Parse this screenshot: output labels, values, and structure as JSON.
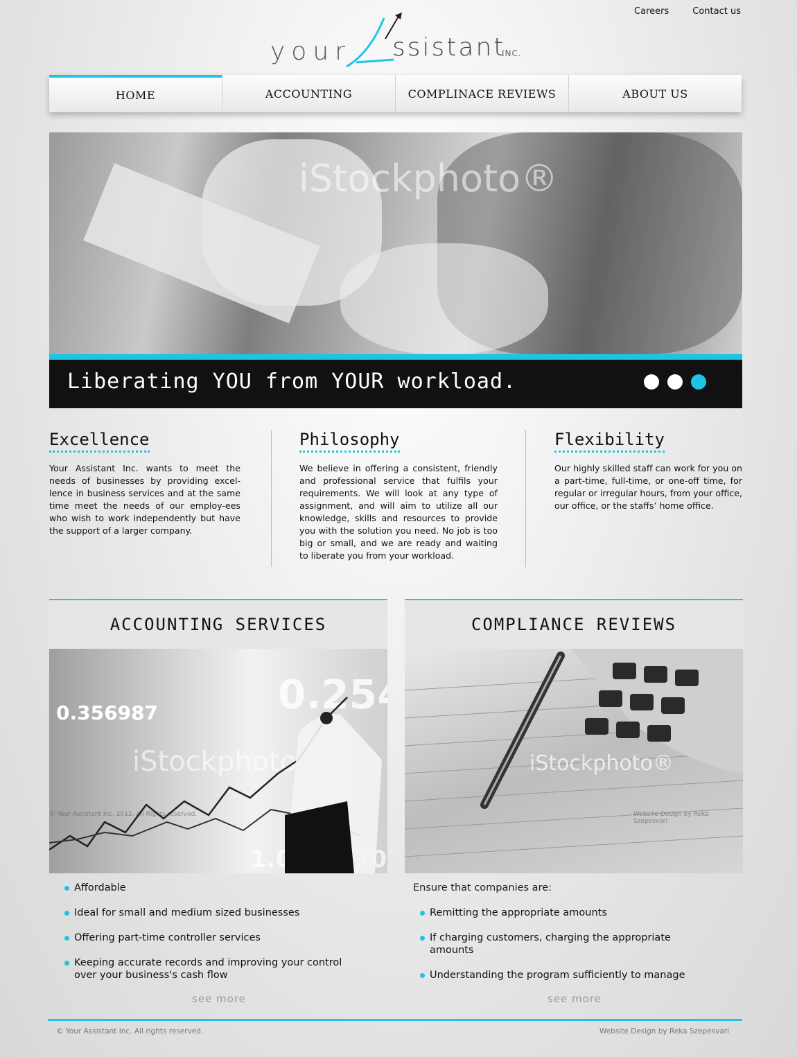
{
  "toplinks": {
    "careers": "Careers",
    "contact": "Contact us"
  },
  "logo": {
    "word1": "your",
    "word2": "ssistant",
    "inc": "INC."
  },
  "nav": [
    {
      "label": "HOME"
    },
    {
      "label": "ACCOUNTING"
    },
    {
      "label": "COMPLINACE  REVIEWS"
    },
    {
      "label": "ABOUT US"
    }
  ],
  "hero": {
    "watermark": "iStockphoto®",
    "caption": "Liberating YOU from YOUR workload.",
    "active_slide": 3,
    "slide_count": 3
  },
  "columns": [
    {
      "title": "Excellence",
      "text": "Your Assistant Inc. wants to meet the needs of businesses by providing excel-lence in business services and at the same time meet the needs of our employ-ees who wish to work independently but have the support of a larger company."
    },
    {
      "title": "Philosophy",
      "text": "We believe in offering a consistent, friendly and professional service that fulfils your requirements. We will look at any type of assignment, and will aim to utilize all our knowledge, skills and resources to provide you with the solution you need. No job is too big or small, and we are ready and waiting to liberate you from your workload."
    },
    {
      "title": "Flexibility",
      "text": "Our highly skilled staff can work for you on a part-time, full-time, or one-off time, for regular or irregular hours, from your office, our office, or the staffs’ home office."
    }
  ],
  "accounting": {
    "title": "ACCOUNTING SERVICES",
    "image_numbers": [
      "0.356987",
      "0.254",
      "1.0",
      "70"
    ],
    "watermark": "iStockphoto",
    "image_copyright": "© Your Assistant Inc. 2012. All Rights reserved.",
    "bullets": [
      "Affordable",
      "Ideal for small and medium sized businesses",
      "Offering part-time controller services",
      "Keeping accurate records and improving your control over your business's cash flow"
    ],
    "more": "see more"
  },
  "compliance": {
    "title": "COMPLIANCE REVIEWS",
    "watermark": "iStockphoto®",
    "image_credit": "Website Design by Reka Szepesvari",
    "intro": "Ensure that companies are:",
    "bullets": [
      "Remitting the appropriate amounts",
      "If charging customers, charging the appropriate amounts",
      "Understanding the program sufficiently to manage"
    ],
    "more": "see more"
  },
  "footer": {
    "copyright": "© Your Assistant Inc. All rights reserved.",
    "credit": "Website Design by Reka Szepesvari"
  },
  "colors": {
    "accent": "#1ec4e6",
    "caption_bg": "#000000"
  }
}
